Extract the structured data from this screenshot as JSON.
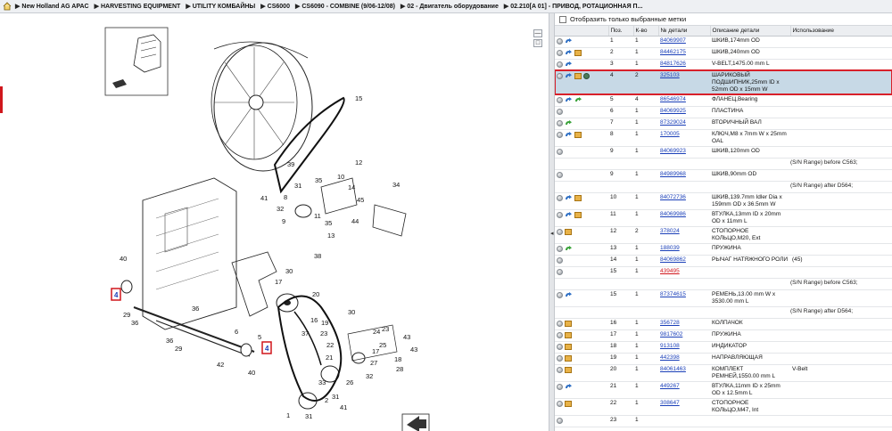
{
  "breadcrumb": [
    "New Holland AG APAC",
    "HARVESTING EQUIPMENT",
    "UTILITY КОМБАЙНЫ",
    "CS6000",
    "CS6090 - COMBINE (9/06-12/08)",
    "02 - Двигатель оборудование",
    "02.210[A 01] - ПРИВОД, РОТАЦИОННАЯ П..."
  ],
  "filter": {
    "label": "Отобразить только выбранные метки"
  },
  "table": {
    "headers": [
      "Поз.",
      "К-во",
      "№ детали",
      "Описание детали",
      "Использование"
    ],
    "rows": [
      {
        "icons": [
          "circle",
          "arrow"
        ],
        "pos": "1",
        "qty": "1",
        "part": "84069907",
        "desc": "ШКИВ,174mm OD",
        "usage": ""
      },
      {
        "icons": [
          "circle",
          "arrow",
          "box"
        ],
        "pos": "2",
        "qty": "1",
        "part": "84462175",
        "desc": "ШКИВ,240mm OD",
        "usage": ""
      },
      {
        "icons": [
          "circle",
          "arrow"
        ],
        "pos": "3",
        "qty": "1",
        "part": "84817626",
        "desc": "V-BELT,1475.00 mm L",
        "usage": ""
      },
      {
        "icons": [
          "circle",
          "arrow",
          "box",
          "globe"
        ],
        "pos": "4",
        "qty": "2",
        "part": "325103",
        "desc": "ШАРИКОВЫЙ ПОДШИПНИК,25mm ID x 52mm OD x 15mm W",
        "usage": "",
        "selected": true
      },
      {
        "icons": [
          "circle",
          "arrow",
          "green"
        ],
        "pos": "5",
        "qty": "4",
        "part": "86546974",
        "desc": "ФЛАНЕЦ,Bearing",
        "usage": ""
      },
      {
        "icons": [
          "circle"
        ],
        "pos": "6",
        "qty": "1",
        "part": "84069925",
        "desc": "ПЛАСТИНА",
        "usage": ""
      },
      {
        "icons": [
          "circle",
          "green"
        ],
        "pos": "7",
        "qty": "1",
        "part": "87329024",
        "desc": "ВТОРИЧНЫЙ ВАЛ",
        "usage": ""
      },
      {
        "icons": [
          "circle",
          "arrow",
          "box"
        ],
        "pos": "8",
        "qty": "1",
        "part": "170005",
        "desc": "КЛЮЧ,M8 x 7mm W x 25mm OAL",
        "usage": ""
      },
      {
        "icons": [
          "circle"
        ],
        "pos": "9",
        "qty": "1",
        "part": "84069923",
        "desc": "ШКИВ,120mm OD",
        "usage": "",
        "note": "(S/N Range) before C563;"
      },
      {
        "icons": [
          "circle"
        ],
        "pos": "9",
        "qty": "1",
        "part": "84989968",
        "desc": "ШКИВ,90mm OD",
        "usage": "",
        "note": "(S/N Range) after D564;"
      },
      {
        "icons": [
          "circle",
          "arrow",
          "box"
        ],
        "pos": "10",
        "qty": "1",
        "part": "84072736",
        "desc": "ШКИВ,139.7mm Idler Dia x 159mm OD x 36.5mm W",
        "usage": ""
      },
      {
        "icons": [
          "circle",
          "arrow",
          "box"
        ],
        "pos": "11",
        "qty": "1",
        "part": "84069986",
        "desc": "ВТУЛКА,13mm ID x 20mm OD x 11mm L",
        "usage": ""
      },
      {
        "icons": [
          "circle",
          "box"
        ],
        "pos": "12",
        "qty": "2",
        "part": "378024",
        "desc": "СТОПОРНОЕ КОЛЬЦО,M20, Ext",
        "usage": ""
      },
      {
        "icons": [
          "circle",
          "green"
        ],
        "pos": "13",
        "qty": "1",
        "part": "188039",
        "desc": "ПРУЖИНА",
        "usage": ""
      },
      {
        "icons": [
          "circle"
        ],
        "pos": "14",
        "qty": "1",
        "part": "84069862",
        "desc": "РЫЧАГ НАТЯЖНОГО РОЛИ",
        "usage": "(45)"
      },
      {
        "icons": [
          "circle"
        ],
        "pos": "15",
        "qty": "1",
        "part": "439495",
        "desc": "",
        "usage": "",
        "red": true,
        "note": "(S/N Range) before C563;"
      },
      {
        "icons": [
          "circle",
          "arrow"
        ],
        "pos": "15",
        "qty": "1",
        "part": "87374615",
        "desc": "РЕМЕНЬ,13.00 mm W x 3530.00 mm L",
        "usage": "",
        "note": "(S/N Range) after D564;"
      },
      {
        "icons": [
          "circle",
          "box"
        ],
        "pos": "16",
        "qty": "1",
        "part": "356728",
        "desc": "КОЛПАЧОК",
        "usage": ""
      },
      {
        "icons": [
          "circle",
          "box"
        ],
        "pos": "17",
        "qty": "1",
        "part": "9817602",
        "desc": "ПРУЖИНА",
        "usage": ""
      },
      {
        "icons": [
          "circle",
          "box"
        ],
        "pos": "18",
        "qty": "1",
        "part": "913108",
        "desc": "ИНДИКАТОР",
        "usage": ""
      },
      {
        "icons": [
          "circle",
          "box"
        ],
        "pos": "19",
        "qty": "1",
        "part": "442398",
        "desc": "НАПРАВЛЯЮЩАЯ",
        "usage": ""
      },
      {
        "icons": [
          "circle",
          "box"
        ],
        "pos": "20",
        "qty": "1",
        "part": "84061463",
        "desc": "КОМПЛЕКТ РЕМНЕЙ,1550.00 mm L",
        "usage": "V-Belt"
      },
      {
        "icons": [
          "circle",
          "arrow"
        ],
        "pos": "21",
        "qty": "1",
        "part": "449267",
        "desc": "ВТУЛКА,11mm ID x 25mm OD x 12.5mm L",
        "usage": ""
      },
      {
        "icons": [
          "circle",
          "box"
        ],
        "pos": "22",
        "qty": "1",
        "part": "308647",
        "desc": "СТОПОРНОЕ КОЛЬЦО,M47, Int",
        "usage": ""
      },
      {
        "icons": [
          "circle"
        ],
        "pos": "23",
        "qty": "1",
        "part": "",
        "desc": "",
        "usage": ""
      }
    ]
  },
  "diagram_labels": [
    "15",
    "39",
    "35",
    "10",
    "12",
    "34",
    "41",
    "32",
    "8",
    "9",
    "14",
    "45",
    "31",
    "11",
    "35",
    "44",
    "13",
    "40",
    "4",
    "29",
    "36",
    "38",
    "30",
    "17",
    "36",
    "29",
    "6",
    "5",
    "4",
    "40",
    "42",
    "42",
    "20",
    "37",
    "16",
    "21",
    "22",
    "23",
    "30",
    "19",
    "24",
    "26",
    "27",
    "25",
    "23",
    "2",
    "31",
    "18",
    "28",
    "1",
    "31",
    "41",
    "33",
    "43",
    "34",
    "32"
  ],
  "colors": {
    "highlight_red": "#d0161c",
    "selected_row": "#c7d9e6",
    "link_blue": "#1a3fb8"
  }
}
